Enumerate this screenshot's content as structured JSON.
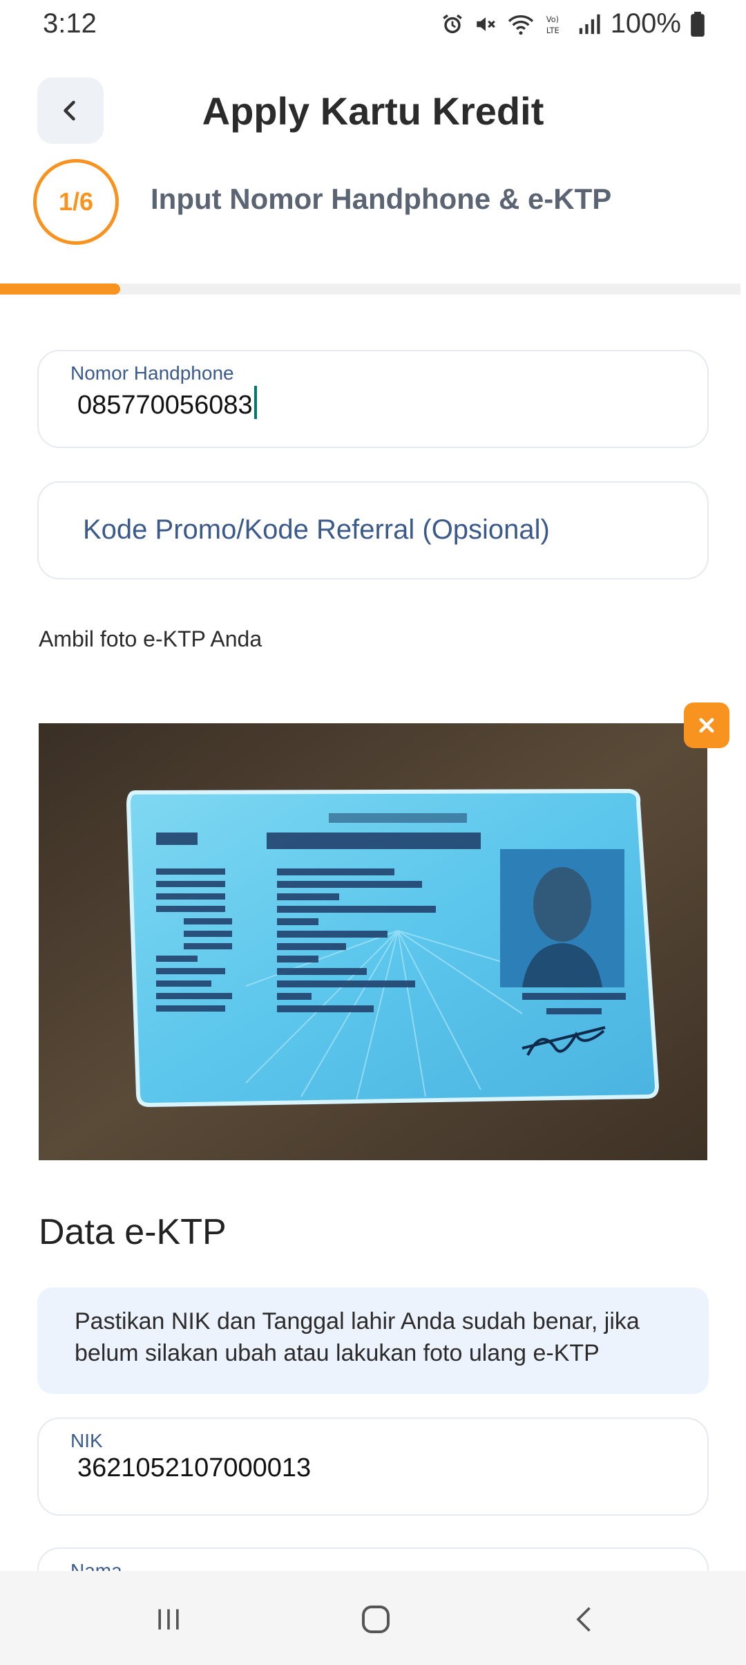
{
  "status_bar": {
    "time": "3:12",
    "battery": "100%",
    "icons": [
      "alarm-icon",
      "mute-icon",
      "wifi-icon",
      "volte-icon",
      "signal-icon",
      "battery-icon"
    ]
  },
  "header": {
    "title": "Apply Kartu Kredit",
    "back_icon": "chevron-left-icon"
  },
  "step": {
    "indicator": "1/6",
    "label": "Input Nomor Handphone & e-KTP",
    "progress": 0.16
  },
  "form": {
    "phone": {
      "label": "Nomor Handphone",
      "value": "085770056083"
    },
    "promo": {
      "placeholder": "Kode Promo/Kode Referral (Opsional)"
    }
  },
  "photo_section": {
    "caption": "Ambil foto e-KTP Anda",
    "remove_icon": "close-icon"
  },
  "ektp": {
    "title": "Data e-KTP",
    "notice": "Pastikan NIK dan Tanggal lahir Anda sudah benar, jika belum silakan ubah atau lakukan foto ulang e-KTP",
    "nik": {
      "label": "NIK",
      "value": "3621052107000013"
    },
    "nama": {
      "label": "Nama"
    }
  },
  "colors": {
    "accent": "#f7931e",
    "label_blue": "#3b5a8a",
    "notice_bg": "#edf3fd"
  }
}
